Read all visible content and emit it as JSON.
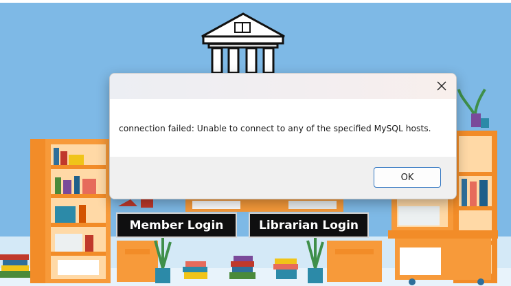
{
  "background": {
    "sky_color": "#7eb9e6",
    "floor_color": "#cfe6f5",
    "accent_orange": "#f28c28",
    "buttons": {
      "member_label": "Member Login",
      "librarian_label": "Librarian Login"
    }
  },
  "dialog": {
    "close_icon": "close-icon",
    "message": "connection failed: Unable to connect to any of the specified MySQL hosts.",
    "ok_label": "OK",
    "ok_border_color": "#2f74c0"
  }
}
